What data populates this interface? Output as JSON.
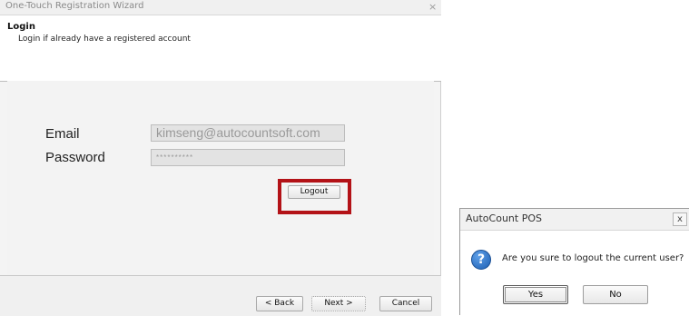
{
  "wizard": {
    "title": "One-Touch Registration Wizard",
    "close_glyph": "×",
    "heading": "Login",
    "subheading": "Login if already have a registered account",
    "email_label": "Email",
    "email_value": "kimseng@autocountsoft.com",
    "password_label": "Password",
    "password_value": "**********",
    "logout_label": "Logout",
    "back_label": "< Back",
    "next_label": "Next >",
    "cancel_label": "Cancel",
    "highlight_color": "#b31217"
  },
  "dialog": {
    "title": "AutoCount POS",
    "close_glyph": "x",
    "icon": "question-icon",
    "icon_glyph": "?",
    "message": "Are you sure to logout the current user?",
    "yes_label": "Yes",
    "no_label": "No"
  }
}
